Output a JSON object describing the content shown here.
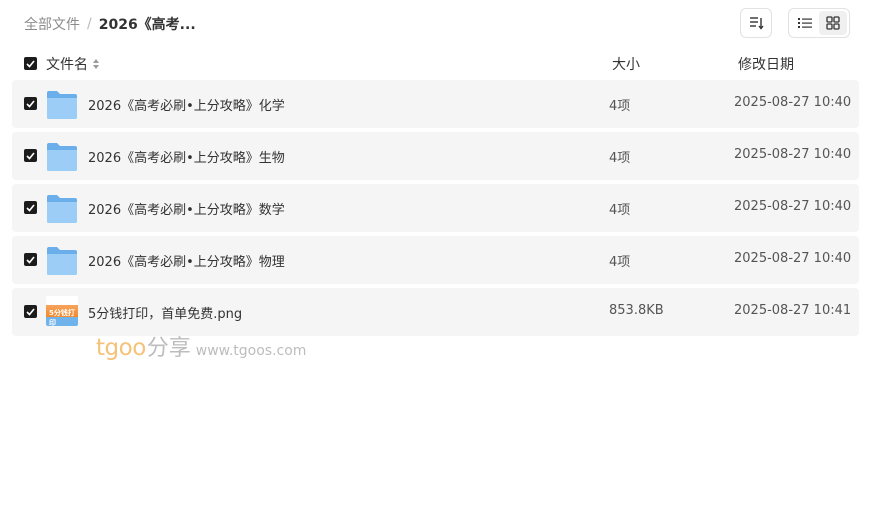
{
  "breadcrumb": {
    "root": "全部文件",
    "separator": "/",
    "current": "2026《高考..."
  },
  "toolbar": {
    "sort_icon": "sort-icon",
    "list_icon": "list-view-icon",
    "grid_icon": "grid-view-icon"
  },
  "header": {
    "name": "文件名",
    "size": "大小",
    "date": "修改日期"
  },
  "files": [
    {
      "name": "2026《高考必刷•上分攻略》化学",
      "size": "4项",
      "date": "2025-08-27 10:40",
      "type": "folder"
    },
    {
      "name": "2026《高考必刷•上分攻略》生物",
      "size": "4项",
      "date": "2025-08-27 10:40",
      "type": "folder"
    },
    {
      "name": "2026《高考必刷•上分攻略》数学",
      "size": "4项",
      "date": "2025-08-27 10:40",
      "type": "folder"
    },
    {
      "name": "2026《高考必刷•上分攻略》物理",
      "size": "4项",
      "date": "2025-08-27 10:40",
      "type": "folder"
    },
    {
      "name": "5分钱打印，首单免费.png",
      "size": "853.8KB",
      "date": "2025-08-27 10:41",
      "type": "image"
    }
  ],
  "image_thumb_text": "5分钱打印",
  "watermark": {
    "logo": "tgoo",
    "cn": "分享",
    "url": "www.tgoos.com"
  },
  "colors": {
    "folder": "#7db9ef",
    "row_bg": "#f5f5f5",
    "checkbox": "#1c1c1c",
    "watermark_logo": "#f5c27a"
  }
}
